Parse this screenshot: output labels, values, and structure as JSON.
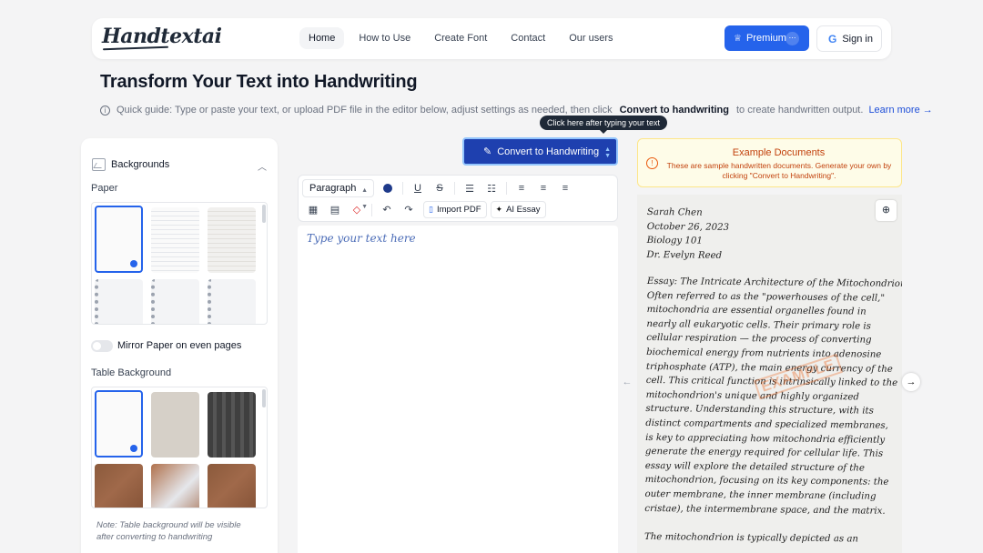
{
  "nav": {
    "logo": "Handtextai",
    "links": [
      "Home",
      "How to Use",
      "Create Font",
      "Contact",
      "Our users"
    ],
    "premium_label": "Premium",
    "signin_label": "Sign in"
  },
  "header": {
    "title": "Transform Your Text into Handwriting",
    "guide_text": "Quick guide: Type or paste your text, or upload PDF file in the editor below, adjust settings as needed, then click",
    "guide_button_text": "Convert to handwriting",
    "guide_suffix": "to create handwritten output.",
    "learn_more": "Learn more →",
    "tooltip": "Click here after typing your text"
  },
  "left_panel": {
    "section_title": "Backgrounds",
    "paper_label": "Paper",
    "mirror_label": "Mirror Paper on even pages",
    "table_bg_label": "Table Background",
    "note": "Note: Table background will be visible after converting to handwriting"
  },
  "editor": {
    "convert_label": "Convert to Handwriting",
    "paragraph_select": "Paragraph",
    "import_pdf": "Import PDF",
    "ai_essay": "AI Essay",
    "placeholder": "Type your text here",
    "text_color": "#1e3a8a"
  },
  "example": {
    "title": "Example Documents",
    "text": "These are sample handwritten documents. Generate your own by clicking \"Convert to Handwriting\".",
    "stamp": "EXAMPLE",
    "header_lines": [
      "Sarah Chen",
      "October 26, 2023",
      "Biology 101",
      "Dr. Evelyn Reed"
    ],
    "body_lines": [
      "Essay: The Intricate Architecture of the Mitochondrion",
      "Often referred to as the \"powerhouses of the cell,\"",
      "mitochondria are essential organelles found in",
      "nearly all eukaryotic cells. Their primary role is",
      "cellular respiration — the process of converting",
      "biochemical energy from nutrients into adenosine",
      "triphosphate (ATP), the main energy currency of the",
      "cell. This critical function is intrinsically linked to the",
      "mitochondrion's unique and highly organized",
      "structure. Understanding this structure, with its",
      "distinct compartments and specialized membranes,",
      "is key to appreciating how mitochondria efficiently",
      "generate the energy required for cellular life. This",
      "essay will explore the detailed structure of the",
      "mitochondrion, focusing on its key components: the",
      "outer membrane, the inner membrane (including",
      "cristae), the intermembrane space, and the matrix.",
      "",
      "The mitochondrion is typically depicted as an"
    ]
  }
}
